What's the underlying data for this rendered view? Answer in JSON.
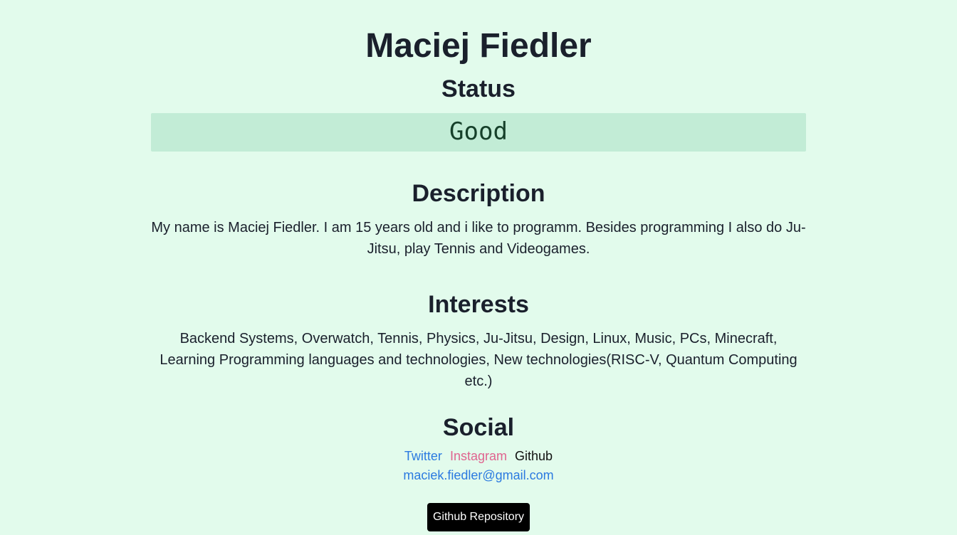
{
  "profile": {
    "name": "Maciej Fiedler"
  },
  "status": {
    "heading": "Status",
    "value": "Good"
  },
  "description": {
    "heading": "Description",
    "text": "My name is Maciej Fiedler. I am 15 years old and i like to programm. Besides programming I also do Ju-Jitsu, play Tennis and Videogames."
  },
  "interests": {
    "heading": "Interests",
    "text": "Backend Systems, Overwatch, Tennis, Physics, Ju-Jitsu, Design, Linux, Music, PCs, Minecraft, Learning Programming languages and technologies, New technologies(RISC-V, Quantum Computing etc.)"
  },
  "social": {
    "heading": "Social",
    "links": {
      "twitter": "Twitter",
      "instagram": "Instagram",
      "github": "Github"
    },
    "email": "maciek.fiedler@gmail.com"
  },
  "repo_button": {
    "label": "Github Repository"
  },
  "colors": {
    "background": "#e2fbec",
    "status_box": "#c2ecd6",
    "link_blue": "#2b7ae0",
    "link_pink": "#e0648f",
    "button_bg": "#000000"
  }
}
